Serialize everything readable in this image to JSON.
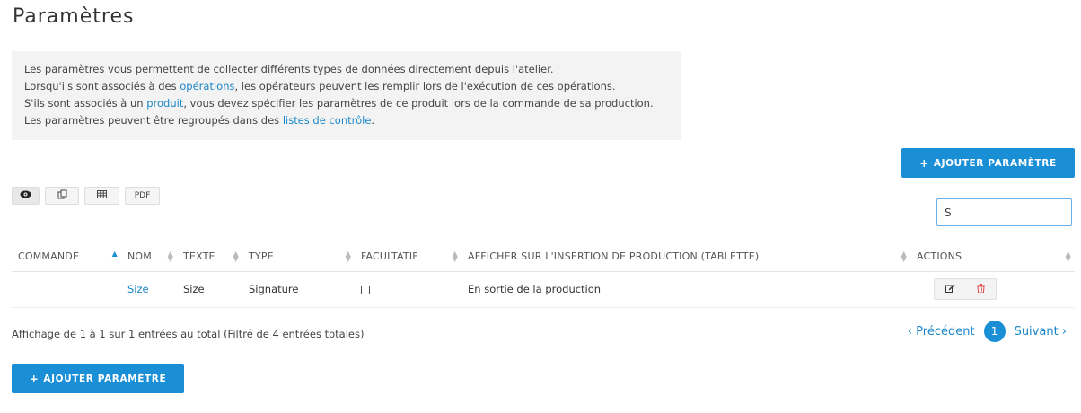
{
  "page": {
    "title": "Paramètres"
  },
  "info": {
    "line1": "Les paramètres vous permettent de collecter différents types de données directement depuis l'atelier.",
    "line2_pre": "Lorsqu'ils sont associés à des ",
    "line2_link": "opérations",
    "line2_post": ", les opérateurs peuvent les remplir lors de l'exécution de ces opérations.",
    "line3_pre": "S'ils sont associés à un ",
    "line3_link": "produit",
    "line3_post": ", vous devez spécifier les paramètres de ce produit lors de la commande de sa production.",
    "line4_pre": "Les paramètres peuvent être regroupés dans des ",
    "line4_link": "listes de contrôle",
    "line4_post": "."
  },
  "buttons": {
    "add_label": "AJOUTER PARAMÈTRE",
    "plus_icon": "+",
    "pdf_label": "PDF"
  },
  "search": {
    "value": "S",
    "placeholder": ""
  },
  "table": {
    "headers": {
      "order": "COMMANDE",
      "name": "NOM",
      "text": "TEXTE",
      "type": "TYPE",
      "optional": "FACULTATIF",
      "display": "AFFICHER SUR L'INSERTION DE PRODUCTION (TABLETTE)",
      "actions": "ACTIONS"
    },
    "rows": [
      {
        "order": "",
        "name": "Size",
        "text": "Size",
        "type": "Signature",
        "optional": false,
        "display": "En sortie de la production"
      }
    ]
  },
  "footer": {
    "summary": "Affichage de 1 à 1 sur 1 entrées au total (Filtré de 4 entrées totales)",
    "prev": "‹ Précédent",
    "current_page": "1",
    "next": "Suivant ›"
  },
  "colors": {
    "accent": "#1a8fd6",
    "danger": "#e04848",
    "info_bg": "#f3f3f3"
  }
}
